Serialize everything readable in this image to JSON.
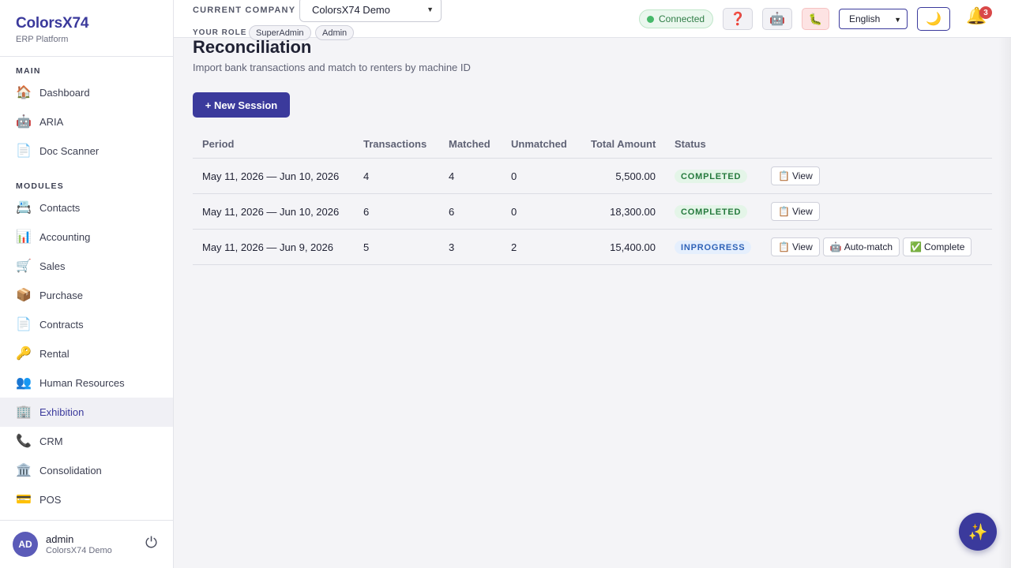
{
  "brand": {
    "name": "ColorsX74",
    "subtitle": "ERP Platform"
  },
  "sidebar": {
    "main_label": "MAIN",
    "main_items": [
      {
        "label": "Dashboard",
        "icon": "🏠",
        "icon_name": "home-icon"
      },
      {
        "label": "ARIA",
        "icon": "🤖",
        "icon_name": "robot-icon"
      },
      {
        "label": "Doc Scanner",
        "icon": "📄",
        "icon_name": "document-icon"
      }
    ],
    "modules_label": "MODULES",
    "module_items": [
      {
        "label": "Contacts",
        "icon": "📇",
        "icon_name": "card-index-icon"
      },
      {
        "label": "Accounting",
        "icon": "📊",
        "icon_name": "bar-chart-icon"
      },
      {
        "label": "Sales",
        "icon": "🛒",
        "icon_name": "cart-icon"
      },
      {
        "label": "Purchase",
        "icon": "📦",
        "icon_name": "package-icon"
      },
      {
        "label": "Contracts",
        "icon": "📄",
        "icon_name": "document-icon"
      },
      {
        "label": "Rental",
        "icon": "🔑",
        "icon_name": "key-icon"
      },
      {
        "label": "Human Resources",
        "icon": "👥",
        "icon_name": "people-icon"
      },
      {
        "label": "Exhibition",
        "icon": "🏢",
        "icon_name": "building-icon",
        "active": true
      },
      {
        "label": "CRM",
        "icon": "📞",
        "icon_name": "phone-icon"
      },
      {
        "label": "Consolidation",
        "icon": "🏛️",
        "icon_name": "classical-building-icon"
      },
      {
        "label": "POS",
        "icon": "💳",
        "icon_name": "credit-card-icon"
      }
    ]
  },
  "user": {
    "initials": "AD",
    "name": "admin",
    "company": "ColorsX74 Demo",
    "logout_icon": "⏻"
  },
  "topbar": {
    "company_label": "CURRENT COMPANY",
    "company_value": "ColorsX74 Demo",
    "role_label": "YOUR ROLE",
    "roles": [
      "SuperAdmin",
      "Admin"
    ],
    "connection_status": "Connected",
    "help_icon": "❓",
    "bot_icon": "🤖",
    "bug_icon": "🐛",
    "language": "English",
    "theme_icon": "🌙",
    "bell_icon": "🔔",
    "notification_count": "3"
  },
  "page": {
    "title": "Reconciliation",
    "subtitle": "Import bank transactions and match to renters by machine ID",
    "new_session_label": "+ New Session"
  },
  "table": {
    "headers": [
      "Period",
      "Transactions",
      "Matched",
      "Unmatched",
      "Total Amount",
      "Status"
    ],
    "rows": [
      {
        "period": "May 11, 2026 — Jun 10, 2026",
        "transactions": "4",
        "matched": "4",
        "unmatched": "0",
        "amount": "5,500.00",
        "status": "COMPLETED",
        "actions": [
          {
            "icon": "📋",
            "label": "View"
          }
        ]
      },
      {
        "period": "May 11, 2026 — Jun 10, 2026",
        "transactions": "6",
        "matched": "6",
        "unmatched": "0",
        "amount": "18,300.00",
        "status": "COMPLETED",
        "actions": [
          {
            "icon": "📋",
            "label": "View"
          }
        ]
      },
      {
        "period": "May 11, 2026 — Jun 9, 2026",
        "transactions": "5",
        "matched": "3",
        "unmatched": "2",
        "amount": "15,400.00",
        "status": "INPROGRESS",
        "actions": [
          {
            "icon": "📋",
            "label": "View"
          },
          {
            "icon": "🤖",
            "label": "Auto-match"
          },
          {
            "icon": "✅",
            "label": "Complete"
          }
        ]
      }
    ]
  },
  "fab_icon": "✨",
  "colors": {
    "accent": "#3b3a9c",
    "completed": "#257a3d",
    "inprogress": "#2f63b8",
    "badge_red": "#d94848"
  }
}
